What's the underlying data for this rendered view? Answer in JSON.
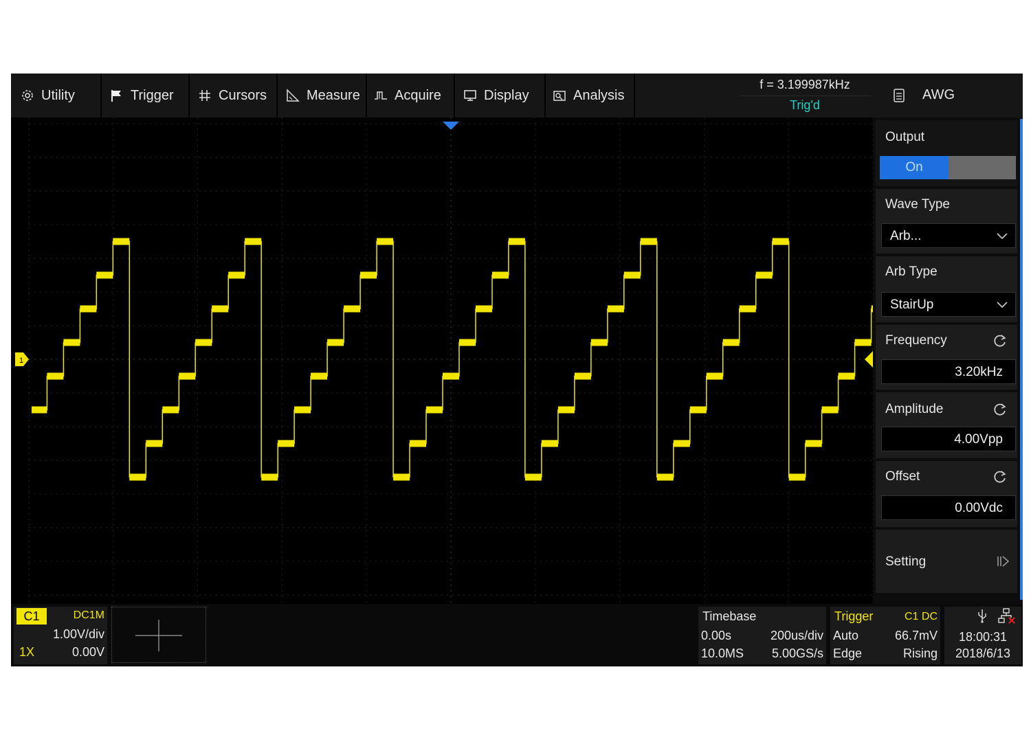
{
  "menu": {
    "items": [
      {
        "label": "Utility",
        "icon": "gear-icon"
      },
      {
        "label": "Trigger",
        "icon": "flag-icon"
      },
      {
        "label": "Cursors",
        "icon": "hash-icon"
      },
      {
        "label": "Measure",
        "icon": "ruler-icon"
      },
      {
        "label": "Acquire",
        "icon": "acquire-icon"
      },
      {
        "label": "Display",
        "icon": "monitor-icon"
      },
      {
        "label": "Analysis",
        "icon": "analysis-icon"
      }
    ],
    "frequency": "f = 3.199987kHz",
    "trigger_status": "Trig'd"
  },
  "awg": {
    "title": "AWG",
    "output_label": "Output",
    "output_state": "On",
    "wave_type_label": "Wave Type",
    "wave_type_value": "Arb...",
    "arb_type_label": "Arb Type",
    "arb_type_value": "StairUp",
    "frequency_label": "Frequency",
    "frequency_value": "3.20kHz",
    "amplitude_label": "Amplitude",
    "amplitude_value": "4.00Vpp",
    "offset_label": "Offset",
    "offset_value": "0.00Vdc",
    "setting_label": "Setting"
  },
  "channel": {
    "name": "C1",
    "coupling": "DC1M",
    "scale": "1.00V/div",
    "probe": "1X",
    "offset": "0.00V",
    "marker": "1"
  },
  "timebase": {
    "label": "Timebase",
    "delay": "0.00s",
    "scale": "200us/div",
    "memory": "10.0MS",
    "sample_rate": "5.00GS/s"
  },
  "trigger": {
    "label": "Trigger",
    "source": "C1 DC",
    "mode": "Auto",
    "level": "66.7mV",
    "type": "Edge",
    "slope": "Rising"
  },
  "status": {
    "time": "18:00:31",
    "date": "2018/6/13"
  },
  "colors": {
    "trace": "#f2e600",
    "accent": "#2c7be5",
    "trig_status": "#22d3c5"
  },
  "waveform": {
    "frequency_hz": 3200,
    "steps_per_period": 8,
    "volts_per_div": 1.0,
    "time_per_div_us": 200,
    "level_min_v": -3.5,
    "level_max_v": 3.5
  }
}
